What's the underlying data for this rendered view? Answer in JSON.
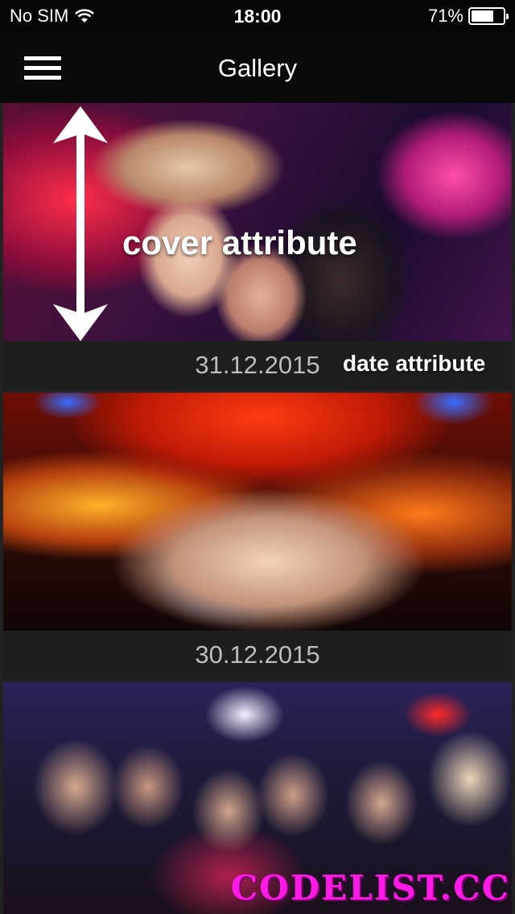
{
  "status_bar": {
    "carrier": "No SIM",
    "time": "18:00",
    "battery_percent": "71%",
    "battery_level": 0.71,
    "icons": [
      "wifi-icon",
      "battery-icon"
    ]
  },
  "nav_bar": {
    "title": "Gallery",
    "menu_icon": "hamburger-menu-icon"
  },
  "gallery": {
    "items": [
      {
        "date": "31.12.2015"
      },
      {
        "date": "30.12.2015"
      },
      {
        "date": ""
      }
    ]
  },
  "annotations": {
    "cover_label": "cover attribute",
    "date_label": "date attribute",
    "arrow_icon": "double-arrow-vertical-icon"
  },
  "watermark": "CODELIST.CC",
  "colors": {
    "background": "#000000",
    "date_text": "#bdbdbd",
    "watermark": "#ff19e6"
  }
}
